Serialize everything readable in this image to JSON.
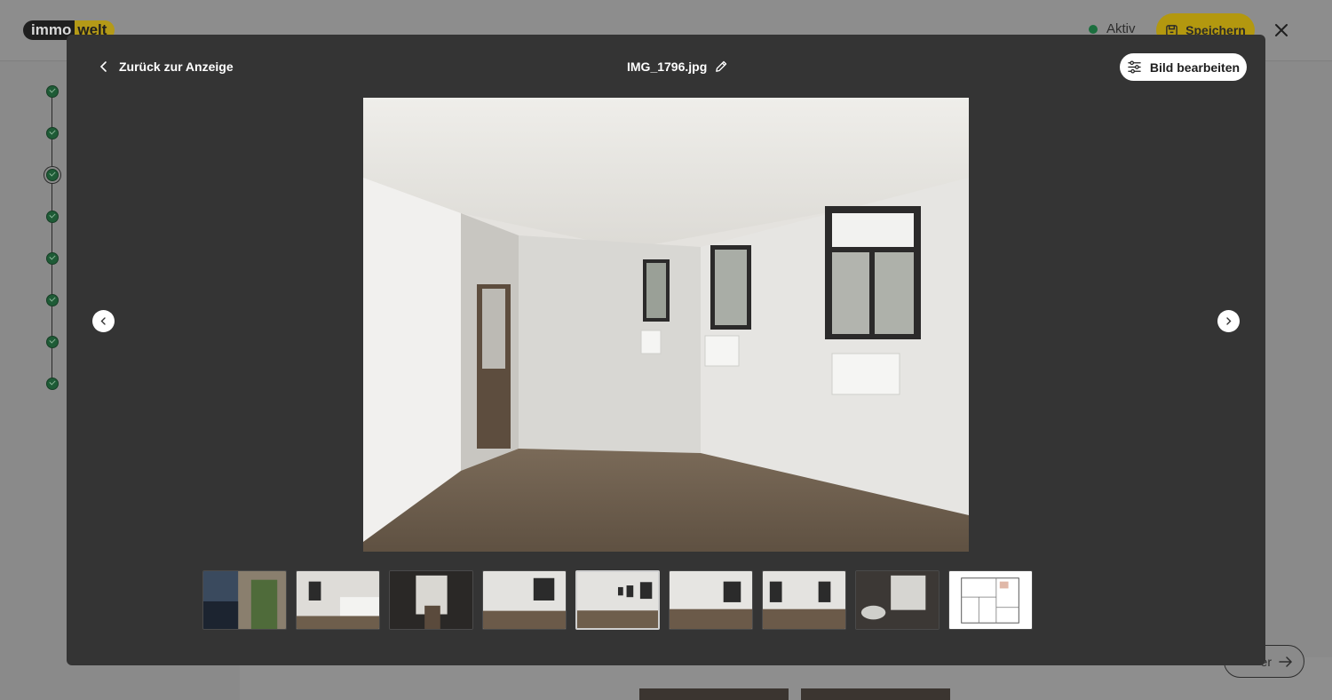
{
  "header": {
    "logo_part1": "immo",
    "logo_part2": "welt",
    "status_label": "Aktiv",
    "save_label": "Speichern",
    "close_icon": "close-icon"
  },
  "stepper": {
    "steps": [
      "completed",
      "completed",
      "current",
      "completed",
      "completed",
      "completed",
      "completed",
      "completed"
    ]
  },
  "background": {
    "next_label": "er"
  },
  "viewer": {
    "back_label": "Zurück zur Anzeige",
    "filename": "IMG_1796.jpg",
    "edit_image_label": "Bild bearbeiten",
    "icons": {
      "back": "chevron-left-icon",
      "rename": "pencil-icon",
      "edit": "sliders-icon",
      "prev": "chevron-left-icon",
      "next": "chevron-right-icon"
    },
    "current_index": 5,
    "thumbnails": [
      {
        "subject": "building-facade"
      },
      {
        "subject": "kitchen"
      },
      {
        "subject": "hallway-stairs"
      },
      {
        "subject": "room-window"
      },
      {
        "subject": "living-room",
        "selected": true
      },
      {
        "subject": "room-window-2"
      },
      {
        "subject": "room-two-windows"
      },
      {
        "subject": "bathroom"
      },
      {
        "subject": "floor-plan"
      }
    ]
  },
  "colors": {
    "overlay": "#8a8a8a",
    "modal": "#343434",
    "status_green": "#1b6e3e",
    "brand_yellow": "#b3980f"
  }
}
